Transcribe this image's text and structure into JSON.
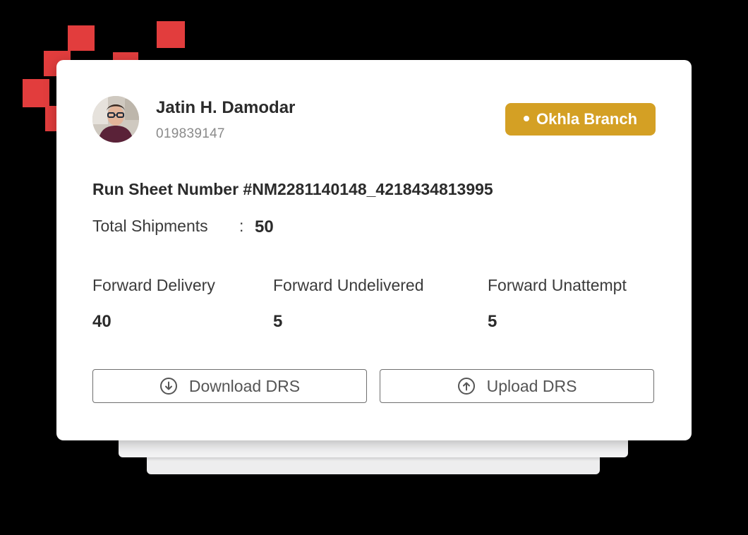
{
  "user": {
    "name": "Jatin H. Damodar",
    "id": "019839147"
  },
  "branch": {
    "label": "Okhla Branch",
    "color": "#d4a024"
  },
  "run_sheet": {
    "label": "Run Sheet Number #NM2281140148_4218434813995"
  },
  "total_shipments": {
    "label": "Total Shipments",
    "separator": ":",
    "value": "50"
  },
  "stats": [
    {
      "label": "Forward Delivery",
      "value": "40"
    },
    {
      "label": "Forward Undelivered",
      "value": "5"
    },
    {
      "label": "Forward Unattempt",
      "value": "5"
    }
  ],
  "actions": {
    "download_label": "Download DRS",
    "download_icon": "download-circle-icon",
    "upload_label": "Upload DRS",
    "upload_icon": "upload-circle-icon"
  },
  "colors": {
    "accent_squares": "#e23d3d",
    "badge": "#d4a024"
  }
}
